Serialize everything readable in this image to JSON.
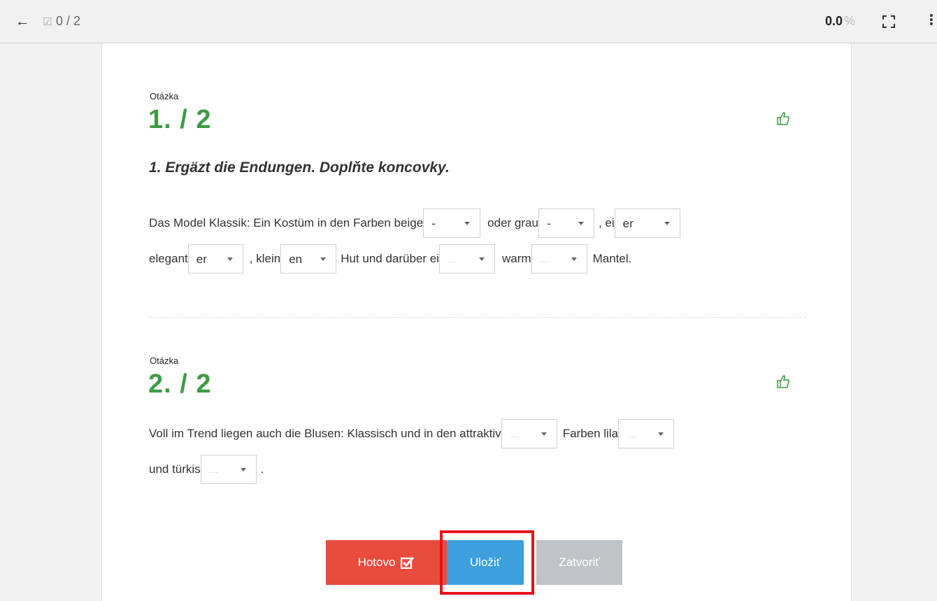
{
  "topbar": {
    "progress": "0 / 2",
    "score_value": "0.0",
    "score_unit": "%"
  },
  "colors": {
    "question_number": "#3e9b43",
    "done_button": "#e74c3c",
    "save_button": "#3d9fdc",
    "close_button": "#c1c4c6",
    "highlight": "#e8111c"
  },
  "question1": {
    "label": "Otázka",
    "number": "1. / 2",
    "instruction": "1. Ergäzt die Endungen. Doplňte koncovky.",
    "line1": {
      "t1": "Das Model Klassik: Ein Kostüm in den Farben beige",
      "s1": "-",
      "t2": " oder grau",
      "s2": "-",
      "t3": ", ei",
      "s3": "er"
    },
    "line2": {
      "t1": "elegant",
      "s1": "er",
      "t2": ", klein",
      "s2": "en",
      "t3": " Hut und darüber ei",
      "s3": "....",
      "t4": " warm",
      "s4": "....",
      "t5": " Mantel."
    }
  },
  "question2": {
    "label": "Otázka",
    "number": "2. / 2",
    "line1": {
      "t1": "Voll im Trend liegen auch die Blusen: Klassisch und in den attraktiv",
      "s1": "....",
      "t2": " Farben lila",
      "s2": "...."
    },
    "line2": {
      "t1": "und türkis",
      "s1": "....",
      "t2": " ."
    }
  },
  "buttons": {
    "done": "Hotovo",
    "save": "Uložiť",
    "close": "Zatvoriť"
  },
  "icons": {
    "back": "arrow-left-icon",
    "progress": "checkbox-icon",
    "fullscreen": "expand-icon",
    "menu": "more-vertical-icon",
    "feedback": "thumbs-up-icon",
    "done": "check-square-icon"
  }
}
